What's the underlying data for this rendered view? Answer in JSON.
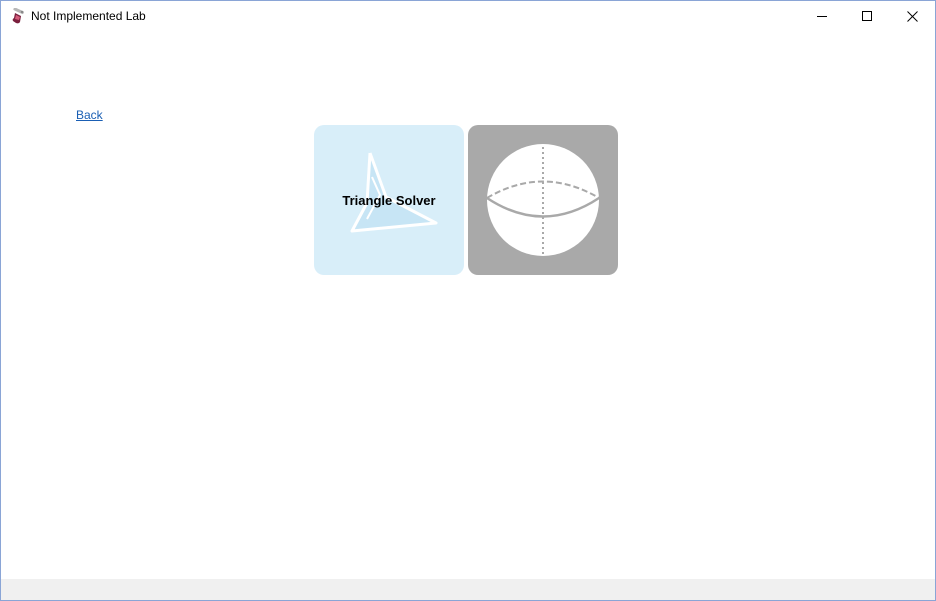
{
  "window": {
    "title": "Not Implemented Lab",
    "app_icon": "flask-icon",
    "controls": {
      "minimize_icon": "minimize-icon",
      "maximize_icon": "maximize-icon",
      "close_icon": "close-icon"
    }
  },
  "nav": {
    "back_label": "Back"
  },
  "tiles": [
    {
      "label": "Triangle Solver",
      "icon": "triangle-icon",
      "background": "#d8eef9"
    },
    {
      "label": "",
      "icon": "sphere-icon",
      "background": "#a9a9a9"
    }
  ],
  "colors": {
    "link": "#1a5fb4",
    "window_border": "#8aa5d6",
    "statusbar": "#f0f0f0"
  }
}
